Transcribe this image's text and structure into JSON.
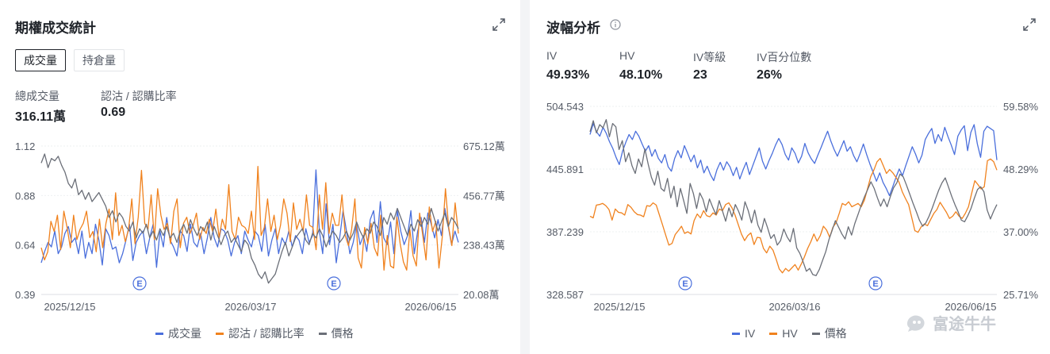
{
  "colors": {
    "blue": "#4a6fdc",
    "orange": "#f0821e",
    "gray": "#6b6f78",
    "text": "#1f2329",
    "muted": "#555b66"
  },
  "left": {
    "title": "期權成交統計",
    "toggle_volume": "成交量",
    "toggle_oi": "持倉量",
    "stat1_label": "總成交量",
    "stat1_value": "316.11萬",
    "stat2_label": "認沽 / 認購比率",
    "stat2_value": "0.69",
    "legend": [
      "成交量",
      "認沽 / 認購比率",
      "價格"
    ]
  },
  "right": {
    "title": "波幅分析",
    "iv_label": "IV",
    "iv_value": "49.93%",
    "hv_label": "HV",
    "hv_value": "48.10%",
    "ivrank_label": "IV等級",
    "ivrank_value": "23",
    "ivpct_label": "IV百分位數",
    "ivpct_value": "26%",
    "legend": [
      "IV",
      "HV",
      "價格"
    ]
  },
  "watermark": "富途牛牛",
  "chart_data": [
    {
      "type": "line",
      "x_labels": [
        "2025/12/15",
        "2026/03/17",
        "2026/06/15"
      ],
      "y_left_ticks": [
        "1.12",
        "0.88",
        "0.64",
        "0.39"
      ],
      "y_right_ticks": [
        "675.12萬",
        "456.77萬",
        "238.43萬",
        "20.08萬"
      ],
      "ylim_left": [
        0.39,
        1.12
      ],
      "ylim_right": [
        20.08,
        675.12
      ],
      "earnings_markers": [
        "E",
        "E"
      ],
      "series": [
        {
          "name": "成交量",
          "color": "#4a6fdc",
          "axis": "right",
          "values": [
            160,
            210,
            250,
            230,
            300,
            200,
            230,
            290,
            320,
            250,
            270,
            200,
            300,
            180,
            250,
            200,
            330,
            260,
            150,
            310,
            280,
            220,
            230,
            160,
            200,
            260,
            330,
            170,
            250,
            280,
            300,
            200,
            270,
            330,
            140,
            300,
            230,
            360,
            260,
            230,
            190,
            300,
            280,
            210,
            330,
            250,
            230,
            290,
            200,
            270,
            360,
            270,
            230,
            310,
            300,
            260,
            190,
            250,
            280,
            200,
            300,
            260,
            230,
            300,
            280,
            210,
            330,
            190,
            260,
            310,
            200,
            270,
            240,
            300,
            230,
            280,
            260,
            200,
            310,
            250,
            280,
            570,
            300,
            200,
            420,
            240,
            330,
            160,
            270,
            390,
            300,
            200,
            250,
            330,
            240,
            280,
            210,
            350,
            390,
            250,
            430,
            270,
            240,
            340,
            200,
            390,
            300,
            240,
            280,
            390,
            200,
            300,
            360,
            250,
            380,
            330,
            270,
            350,
            280,
            400,
            320,
            240,
            300,
            250
          ]
        },
        {
          "name": "認沽 / 認購比率",
          "color": "#f0821e",
          "axis": "left",
          "values": [
            0.62,
            0.56,
            0.6,
            0.75,
            0.7,
            0.78,
            0.61,
            0.8,
            0.72,
            0.62,
            0.78,
            0.66,
            0.71,
            0.74,
            0.8,
            0.67,
            0.7,
            0.6,
            0.76,
            0.62,
            0.74,
            0.81,
            0.66,
            0.89,
            0.68,
            0.73,
            0.65,
            0.71,
            0.86,
            0.64,
            0.77,
            1.0,
            0.74,
            0.71,
            0.88,
            0.66,
            0.91,
            0.78,
            0.71,
            0.74,
            0.64,
            0.8,
            0.86,
            0.62,
            0.74,
            0.77,
            0.69,
            0.73,
            0.79,
            0.66,
            0.72,
            0.69,
            0.76,
            0.7,
            0.81,
            0.67,
            0.76,
            0.71,
            0.93,
            0.7,
            0.66,
            0.77,
            0.73,
            0.72,
            0.69,
            0.8,
            0.66,
            1.02,
            0.68,
            0.72,
            0.86,
            0.7,
            0.78,
            0.66,
            0.73,
            0.86,
            0.79,
            0.65,
            0.84,
            0.71,
            0.76,
            0.7,
            0.88,
            0.73,
            0.72,
            0.61,
            0.88,
            0.71,
            0.94,
            0.69,
            0.79,
            0.73,
            0.73,
            0.88,
            0.68,
            0.63,
            0.71,
            0.86,
            0.57,
            0.52,
            0.72,
            0.64,
            0.74,
            0.62,
            0.58,
            0.78,
            0.51,
            0.68,
            0.53,
            0.52,
            0.77,
            0.64,
            0.55,
            0.51,
            0.71,
            0.58,
            0.53,
            0.79,
            0.68,
            0.56,
            0.82,
            0.7,
            0.75,
            0.52,
            0.67,
            0.91,
            0.72,
            0.63,
            0.84,
            0.69
          ]
        },
        {
          "name": "價格",
          "color": "#6b6f78",
          "axis": "right",
          "values": [
            600,
            640,
            580,
            620,
            610,
            630,
            590,
            560,
            510,
            490,
            530,
            460,
            480,
            440,
            470,
            430,
            450,
            470,
            440,
            410,
            360,
            390,
            340,
            380,
            360,
            320,
            300,
            340,
            270,
            310,
            290,
            330,
            270,
            300,
            260,
            310,
            280,
            320,
            270,
            290,
            250,
            300,
            330,
            290,
            350,
            310,
            280,
            320,
            300,
            340,
            260,
            320,
            280,
            240,
            280,
            300,
            250,
            270,
            240,
            210,
            260,
            240,
            180,
            150,
            110,
            90,
            120,
            70,
            90,
            110,
            160,
            210,
            250,
            190,
            230,
            270,
            290,
            310,
            260,
            240,
            290,
            270,
            310,
            280,
            230,
            270,
            300,
            280,
            250,
            270,
            300,
            260,
            290,
            340,
            300,
            270,
            310,
            290,
            340,
            320,
            280,
            360,
            330,
            380,
            350,
            400,
            360,
            320,
            280,
            330,
            300,
            350,
            320,
            360,
            330,
            400,
            350,
            300,
            340,
            380,
            320,
            360,
            340,
            310
          ]
        }
      ]
    },
    {
      "type": "line",
      "x_labels": [
        "2025/12/15",
        "2026/03/16",
        "2026/06/15"
      ],
      "y_left_ticks": [
        "504.543",
        "445.891",
        "387.239",
        "328.587"
      ],
      "y_right_ticks": [
        "59.58%",
        "48.29%",
        "37.00%",
        "25.71%"
      ],
      "ylim_left": [
        328.587,
        504.543
      ],
      "ylim_right": [
        25.71,
        59.58
      ],
      "earnings_markers": [
        "E",
        "E"
      ],
      "series": [
        {
          "name": "IV",
          "color": "#4a6fdc",
          "axis": "right",
          "values": [
            54.5,
            56.5,
            55.0,
            54.2,
            55.8,
            54.7,
            53.2,
            52.0,
            50.4,
            49.1,
            51.5,
            53.1,
            54.5,
            53.6,
            55.1,
            54.2,
            52.8,
            51.5,
            52.5,
            50.6,
            51.8,
            50.2,
            49.4,
            50.9,
            48.7,
            47.9,
            50.2,
            51.6,
            50.3,
            52.5,
            51.1,
            49.6,
            50.8,
            48.5,
            49.9,
            47.6,
            48.8,
            47.3,
            46.2,
            48.2,
            49.5,
            48.1,
            49.6,
            48.7,
            47.1,
            48.6,
            46.5,
            48.1,
            49.5,
            47.3,
            48.9,
            50.5,
            52.1,
            49.7,
            48.3,
            49.8,
            51.1,
            52.6,
            53.8,
            52.7,
            50.9,
            49.9,
            52.1,
            51.1,
            49.4,
            50.6,
            52.9,
            51.2,
            50.1,
            49.3,
            50.8,
            52.2,
            53.7,
            55.1,
            53.3,
            51.8,
            50.6,
            52.0,
            53.4,
            51.5,
            52.3,
            50.7,
            49.6,
            51.1,
            52.8,
            50.9,
            49.2,
            47.7,
            46.1,
            47.6,
            45.9,
            44.8,
            43.5,
            45.1,
            46.8,
            48.3,
            47.1,
            48.9,
            50.6,
            52.3,
            51.0,
            49.4,
            50.8,
            53.6,
            54.7,
            55.6,
            52.9,
            54.5,
            53.3,
            55.8,
            54.1,
            52.6,
            50.9,
            54.2,
            55.3,
            56.1,
            51.6,
            54.9,
            56.3,
            52.8,
            50.4,
            55.1,
            56.0,
            55.6,
            55.2,
            49.9
          ]
        },
        {
          "name": "HV",
          "color": "#f0821e",
          "axis": "right",
          "values": [
            39.8,
            39.5,
            41.8,
            41.9,
            42.1,
            41.7,
            41.0,
            39.1,
            41.1,
            40.5,
            40.4,
            40.0,
            41.9,
            41.4,
            40.6,
            40.1,
            40.0,
            39.7,
            41.7,
            41.6,
            42.2,
            41.8,
            40.0,
            38.2,
            36.4,
            34.6,
            34.9,
            36.5,
            37.2,
            38.0,
            36.7,
            37.0,
            36.6,
            39.0,
            40.2,
            39.5,
            40.8,
            39.9,
            39.7,
            40.4,
            40.0,
            41.1,
            40.8,
            41.9,
            42.2,
            41.3,
            40.0,
            38.3,
            36.6,
            35.4,
            36.3,
            36.8,
            34.7,
            36.0,
            35.9,
            34.0,
            33.2,
            34.4,
            33.7,
            32.1,
            30.3,
            29.6,
            30.4,
            29.9,
            30.5,
            31.1,
            30.1,
            31.2,
            32.5,
            34.0,
            35.2,
            36.6,
            35.3,
            36.3,
            38.0,
            37.3,
            36.0,
            37.8,
            38.6,
            40.3,
            42.1,
            41.8,
            42.4,
            41.5,
            41.8,
            42.1,
            41.5,
            42.7,
            44.8,
            46.9,
            48.1,
            49.6,
            50.2,
            48.9,
            47.5,
            48.2,
            47.6,
            46.8,
            45.9,
            44.2,
            43.0,
            41.9,
            39.6,
            37.2,
            36.9,
            37.9,
            38.4,
            38.1,
            39.2,
            40.3,
            41.0,
            42.3,
            41.4,
            40.5,
            39.4,
            39.8,
            40.6,
            39.8,
            39.4,
            40.3,
            41.5,
            43.9,
            46.2,
            45.5,
            44.7,
            45.1,
            49.8,
            50.1,
            49.6,
            48.1
          ]
        },
        {
          "name": "價格",
          "color": "#6b6f78",
          "axis": "right",
          "values": [
            55.0,
            57.0,
            54.8,
            56.3,
            55.7,
            57.2,
            54.1,
            56.5,
            55.9,
            51.8,
            53.4,
            49.6,
            51.2,
            48.9,
            47.5,
            50.1,
            48.7,
            51.9,
            49.2,
            46.8,
            45.4,
            47.9,
            44.8,
            44.3,
            46.6,
            43.1,
            45.2,
            41.5,
            44.8,
            42.6,
            40.3,
            45.7,
            43.9,
            41.2,
            44.0,
            42.8,
            40.6,
            42.9,
            41.4,
            40.1,
            42.6,
            40.8,
            38.9,
            41.3,
            39.7,
            41.9,
            40.7,
            39.1,
            42.4,
            40.8,
            38.6,
            40.9,
            38.2,
            36.9,
            39.4,
            37.7,
            35.8,
            36.5,
            34.6,
            35.4,
            37.5,
            36.1,
            35.2,
            37.6,
            34.1,
            33.1,
            31.6,
            29.9,
            30.4,
            29.3,
            29.1,
            30.2,
            31.8,
            33.4,
            35.6,
            37.3,
            39.0,
            37.8,
            36.6,
            35.7,
            37.9,
            36.4,
            38.5,
            40.1,
            41.8,
            43.3,
            44.6,
            46.0,
            44.8,
            43.1,
            41.6,
            42.9,
            41.5,
            43.3,
            44.9,
            45.8,
            47.4,
            46.9,
            45.4,
            43.8,
            42.2,
            40.7,
            39.1,
            38.0,
            38.6,
            39.8,
            41.3,
            42.9,
            44.5,
            45.8,
            46.7,
            45.1,
            43.4,
            41.9,
            40.6,
            39.1,
            38.8,
            39.9,
            41.2,
            43.0,
            44.6,
            45.1,
            44.2,
            40.9,
            39.3,
            40.7,
            41.9
          ]
        }
      ]
    }
  ]
}
